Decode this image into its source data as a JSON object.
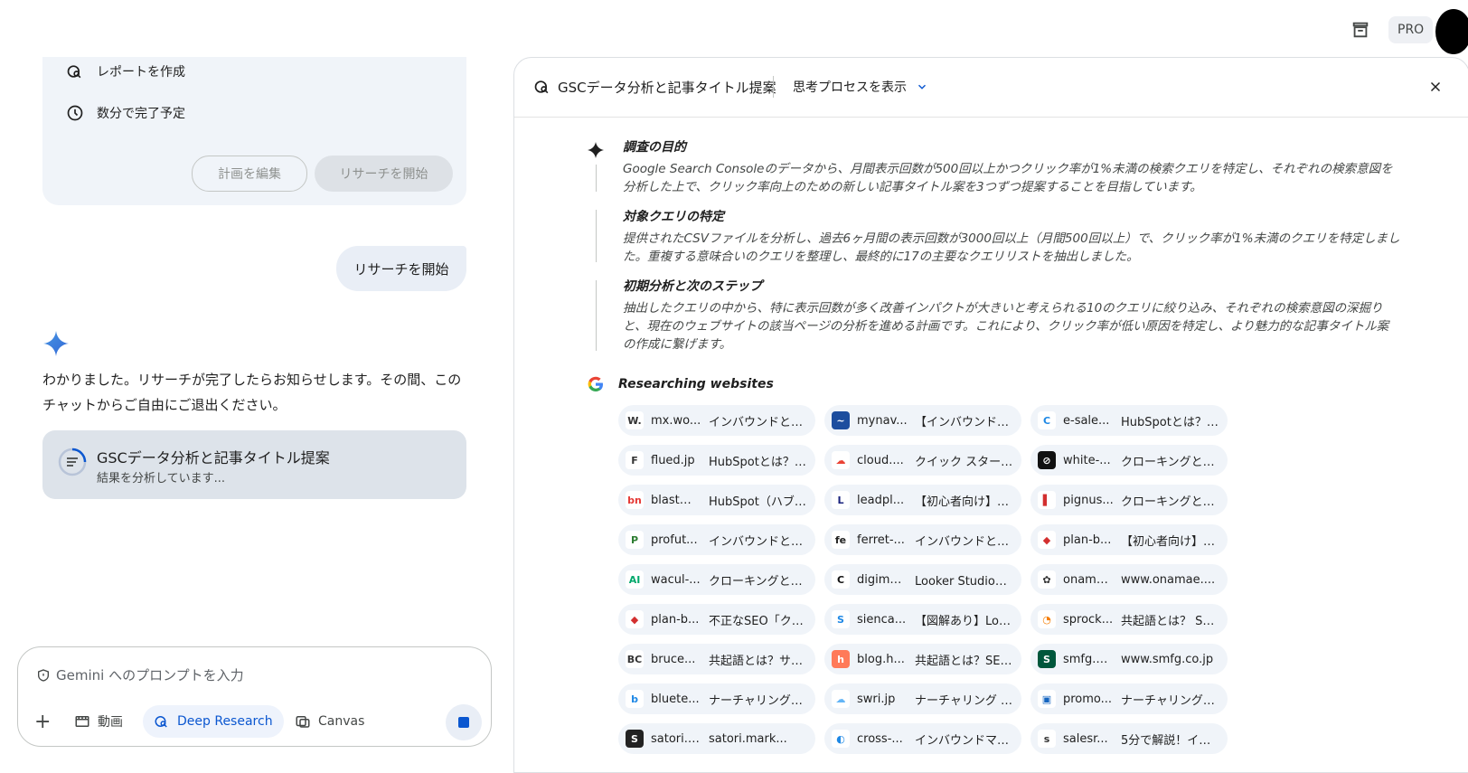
{
  "topbar": {
    "pro_label": "PRO"
  },
  "plan": {
    "items": [
      {
        "label": "レポートを作成",
        "icon": "report-search-icon"
      },
      {
        "label": "数分で完了予定",
        "icon": "clock-icon"
      }
    ],
    "edit_label": "計画を編集",
    "start_label": "リサーチを開始"
  },
  "user_message": "リサーチを開始",
  "assistant_reply": "わかりました。リサーチが完了したらお知らせします。その間、このチャットからご自由にご退出ください。",
  "research_card": {
    "title": "GSCデータ分析と記事タイトル提案",
    "status": "結果を分析しています..."
  },
  "input": {
    "placeholder": "Gemini へのプロンプトを入力",
    "tools": {
      "add": "+",
      "video": "動画",
      "deep_research": "Deep Research",
      "canvas": "Canvas"
    }
  },
  "panel": {
    "title": "GSCデータ分析と記事タイトル提案",
    "show_process": "思考プロセスを表示",
    "thoughts": [
      {
        "title": "調査の目的",
        "body": "Google Search Consoleのデータから、月間表示回数が500回以上かつクリック率が1%未満の検索クエリを特定し、それぞれの検索意図を分析した上で、クリック率向上のための新しい記事タイトル案を3つずつ提案することを目指しています。"
      },
      {
        "title": "対象クエリの特定",
        "body": "提供されたCSVファイルを分析し、過去6ヶ月間の表示回数が3000回以上（月間500回以上）で、クリック率が1%未満のクエリを特定しました。重複する意味合いのクエリを整理し、最終的に17の主要なクエリリストを抽出しました。"
      },
      {
        "title": "初期分析と次のステップ",
        "body": "抽出したクエリの中から、特に表示回数が多く改善インパクトが大きいと考えられる10のクエリに絞り込み、それぞれの検索意図の深掘りと、現在のウェブサイトの該当ページの分析を進める計画です。これにより、クリック率が低い原因を特定し、より魅力的な記事タイトル案の作成に繋げます。"
      }
    ],
    "researching_label": "Researching websites",
    "sources": [
      {
        "domain": "mx.wo...",
        "title": "インバウンドとア...",
        "fav": "W.",
        "color": "#ffffff",
        "fg": "#333333"
      },
      {
        "domain": "mynav...",
        "title": "【インバウンド・...",
        "fav": "~",
        "color": "#1d4e9e",
        "fg": "#ffffff"
      },
      {
        "domain": "e-sale...",
        "title": "HubSpotとは？各...",
        "fav": "C",
        "color": "#ffffff",
        "fg": "#1e88e5"
      },
      {
        "domain": "flued.jp",
        "title": "HubSpotとは？選...",
        "fav": "F",
        "color": "#ffffff",
        "fg": "#333333"
      },
      {
        "domain": "cloud....",
        "title": "クイック スタート...",
        "fav": "☁",
        "color": "#ffffff",
        "fg": "#ea4335"
      },
      {
        "domain": "white-...",
        "title": "クローキングとは...",
        "fav": "⊘",
        "color": "#111111",
        "fg": "#ffffff"
      },
      {
        "domain": "blastm...",
        "title": "HubSpot（ハブス...",
        "fav": "bn",
        "color": "#ffffff",
        "fg": "#e53935"
      },
      {
        "domain": "leadpl...",
        "title": "【初心者向け】Hu...",
        "fav": "L",
        "color": "#ffffff",
        "fg": "#1a237e"
      },
      {
        "domain": "pignus...",
        "title": "クローキングとは...",
        "fav": "▌",
        "color": "#ffffff",
        "fg": "#d32f2f"
      },
      {
        "domain": "profut...",
        "title": "インバウンドとは...",
        "fav": "P",
        "color": "#ffffff",
        "fg": "#2e7d32"
      },
      {
        "domain": "ferret-...",
        "title": "インバウンドとア...",
        "fav": "fe",
        "color": "#ffffff",
        "fg": "#222222"
      },
      {
        "domain": "plan-b...",
        "title": "【初心者向け】図...",
        "fav": "◆",
        "color": "#ffffff",
        "fg": "#d32f2f"
      },
      {
        "domain": "wacul-...",
        "title": "クローキングとは...",
        "fav": "AI",
        "color": "#ffffff",
        "fg": "#00a86b"
      },
      {
        "domain": "digima...",
        "title": "Looker Studioの...",
        "fav": "C",
        "color": "#ffffff",
        "fg": "#111111"
      },
      {
        "domain": "onamae.c...",
        "title": "www.onamae....",
        "fav": "✿",
        "color": "#ffffff",
        "fg": "#333333"
      },
      {
        "domain": "plan-b...",
        "title": "不正なSEO「クロ...",
        "fav": "◆",
        "color": "#ffffff",
        "fg": "#d32f2f"
      },
      {
        "domain": "sienca...",
        "title": "【図解あり】Look...",
        "fav": "S",
        "color": "#ffffff",
        "fg": "#1e88e5"
      },
      {
        "domain": "sprock...",
        "title": "共起語とは？ SEO...",
        "fav": "◔",
        "color": "#ffffff",
        "fg": "#f57c00"
      },
      {
        "domain": "bruce...",
        "title": "共起語とは？サジ...",
        "fav": "BC",
        "color": "#ffffff",
        "fg": "#333333"
      },
      {
        "domain": "blog.h...",
        "title": "共起語とは？SEO...",
        "fav": "h",
        "color": "#ff7a59",
        "fg": "#ffffff"
      },
      {
        "domain": "smfg.co.jp",
        "title": "www.smfg.co.jp",
        "fav": "S",
        "color": "#00573c",
        "fg": "#ffffff"
      },
      {
        "domain": "bluete...",
        "title": "ナーチャリング（...",
        "fav": "b",
        "color": "#ffffff",
        "fg": "#1e88e5"
      },
      {
        "domain": "swri.jp",
        "title": "ナーチャリング - I...",
        "fav": "☁",
        "color": "#ffffff",
        "fg": "#64b5f6"
      },
      {
        "domain": "promo...",
        "title": "ナーチャリングと...",
        "fav": "▣",
        "color": "#ffffff",
        "fg": "#1565c0"
      },
      {
        "domain": "satori.mark...",
        "title": "satori.mark...",
        "fav": "S",
        "color": "#222222",
        "fg": "#ffffff"
      },
      {
        "domain": "cross-...",
        "title": "インバウンドマー...",
        "fav": "◐",
        "color": "#ffffff",
        "fg": "#1e88e5"
      },
      {
        "domain": "salesr...",
        "title": "5分で解説！イン...",
        "fav": "s",
        "color": "#ffffff",
        "fg": "#333333"
      }
    ]
  }
}
